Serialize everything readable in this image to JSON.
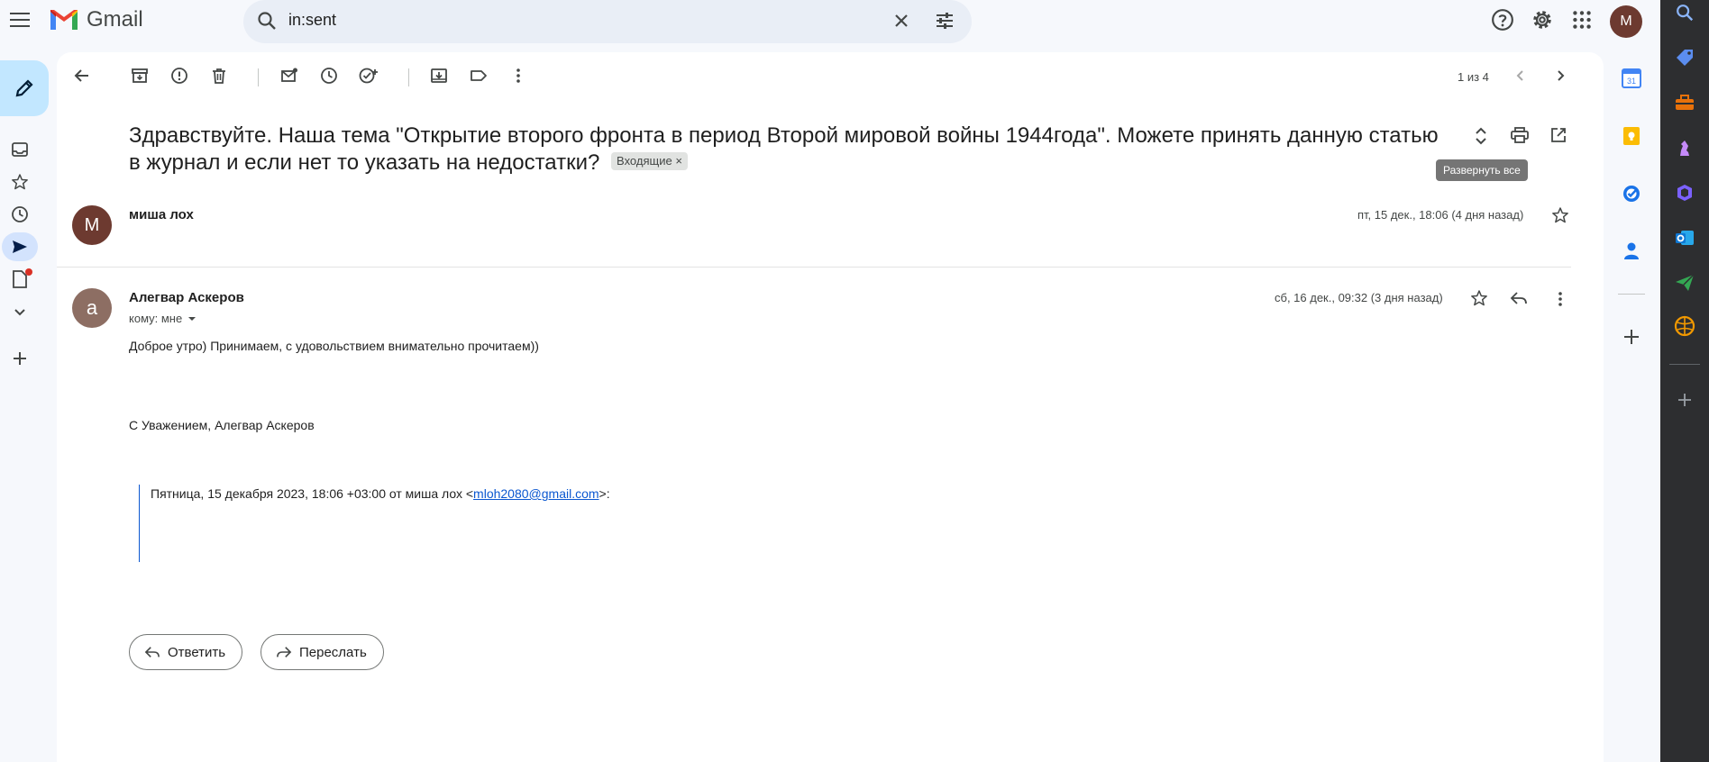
{
  "app": {
    "name": "Gmail"
  },
  "search": {
    "query": "in:sent"
  },
  "account": {
    "initial": "M"
  },
  "toolbar": {
    "pager": "1 из 4"
  },
  "thread": {
    "subject": "Здравствуйте. Наша тема \"Открытие второго фронта в период Второй мировой войны 1944года\". Можете принять данную статью в журнал и если нет то указать на недостатки?",
    "label": "Входящие",
    "tooltip": "Развернуть все"
  },
  "messages": [
    {
      "initial": "M",
      "avatar_color": "#6d3a30",
      "sender": "миша лох",
      "date": "пт, 15 дек., 18:06 (4 дня назад)"
    },
    {
      "initial": "a",
      "avatar_color": "#8d6e63",
      "sender": "Алегвар Аскеров",
      "date": "сб, 16 дек., 09:32 (3 дня назад)",
      "to": "кому: мне",
      "body_line1": "Доброе утро) Принимаем, с удовольствием внимательно прочитаем))",
      "signature": "С Уважением, Алегвар Аскеров",
      "quote_prefix": "Пятница, 15 декабря 2023, 18:06 +03:00 от миша лох <",
      "quote_email": "mloh2080@gmail.com",
      "quote_suffix": ">:"
    }
  ],
  "actions": {
    "reply": "Ответить",
    "forward": "Переслать"
  },
  "colors": {
    "accent": "#0b57d0",
    "compose_bg": "#c2e7ff",
    "unread_dot": "#d93025"
  }
}
